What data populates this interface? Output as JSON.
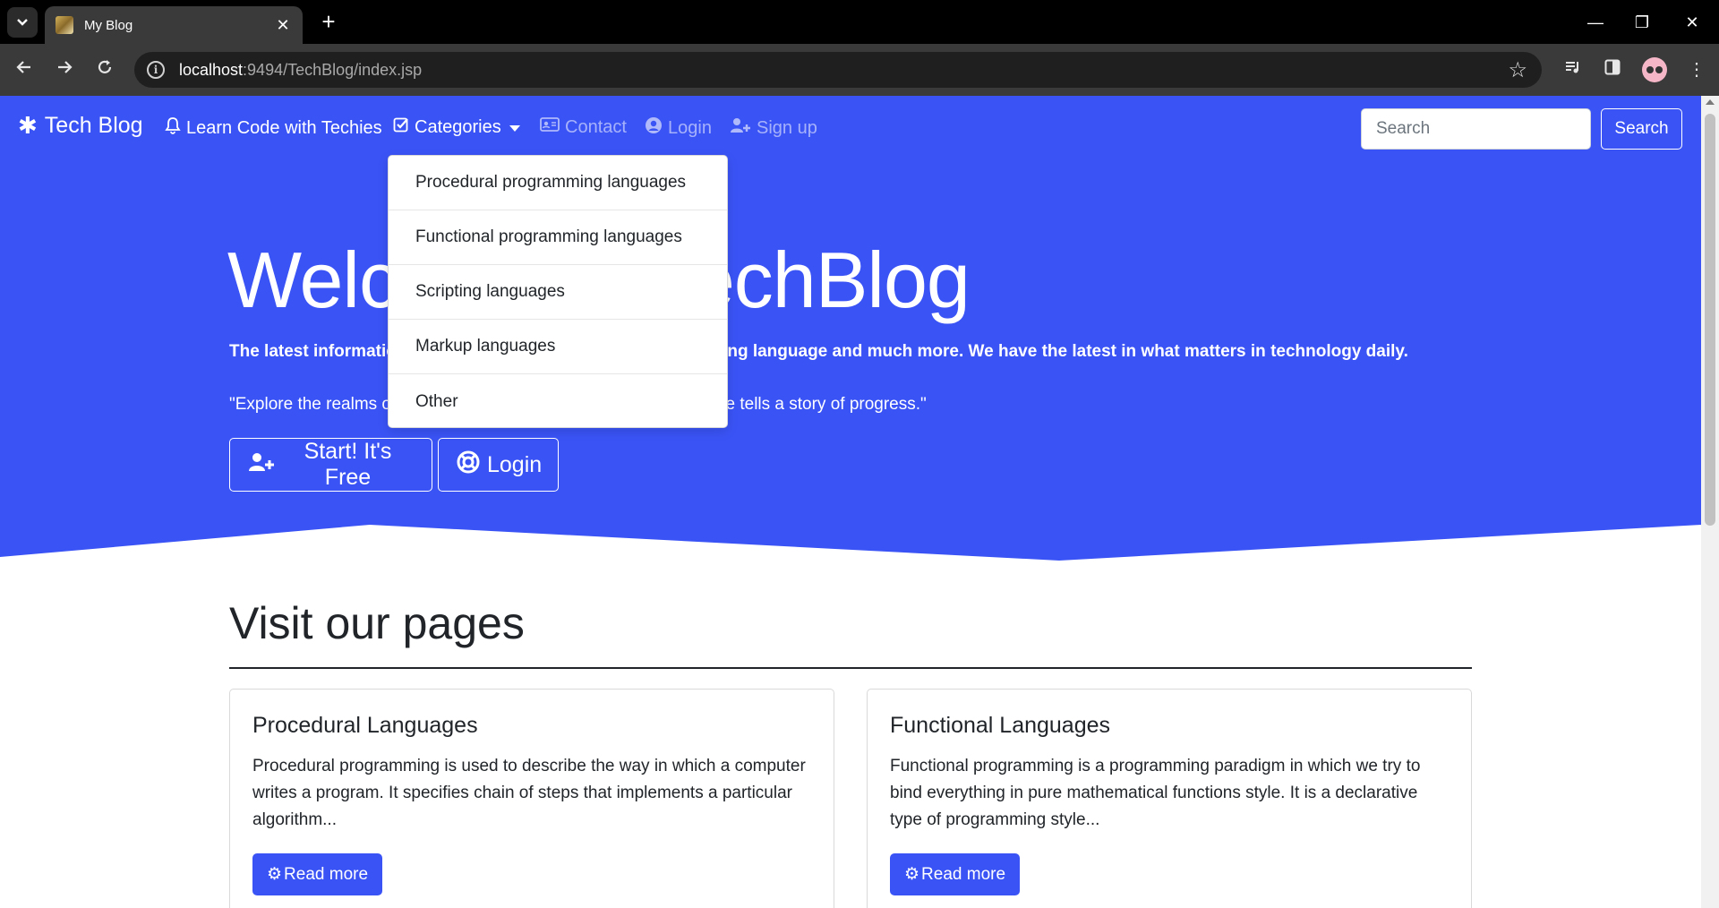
{
  "browser": {
    "tab_title": "My Blog",
    "tab_close": "✕",
    "new_tab": "+",
    "url_host": "localhost",
    "url_rest": ":9494/TechBlog/index.jsp",
    "window_controls": {
      "minimize": "—",
      "restore": "❐",
      "close": "✕"
    }
  },
  "navbar": {
    "brand": "Tech Blog",
    "items": [
      {
        "label": "Learn Code with Techies",
        "icon": "bell-icon"
      },
      {
        "label": "Categories",
        "icon": "check-square-icon"
      },
      {
        "label": "Contact",
        "icon": "address-card-icon"
      },
      {
        "label": "Login",
        "icon": "user-circle-icon"
      },
      {
        "label": "Sign up",
        "icon": "user-plus-icon"
      }
    ],
    "search_placeholder": "Search",
    "search_button": "Search"
  },
  "dropdown": {
    "items": [
      "Procedural programming languages",
      "Functional programming languages",
      "Scripting languages",
      "Markup languages",
      "Other"
    ]
  },
  "hero": {
    "title": "Welcome to TechBlog",
    "lead": "The latest information about computer languages, programming language and much more. We have the latest in what matters in technology daily.",
    "quote": "\"Explore the realms of code, where curiosity, and every line of code tells a story of progress.\"",
    "btn_start": "Start! It's Free",
    "btn_login": "Login"
  },
  "section": {
    "title": "Visit our pages"
  },
  "cards": [
    {
      "title": "Procedural Languages",
      "text": "Procedural programming is used to describe the way in which a computer writes a program. It specifies chain of steps that implements a particular algorithm...",
      "button": "Read more"
    },
    {
      "title": "Functional Languages",
      "text": "Functional programming is a programming paradigm in which we try to bind everything in pure mathematical functions style. It is a declarative type of programming style...",
      "button": "Read more"
    }
  ],
  "colors": {
    "primary": "#3a53f5",
    "chrome_dark": "#000000",
    "chrome_toolbar": "#3a3a3a"
  }
}
